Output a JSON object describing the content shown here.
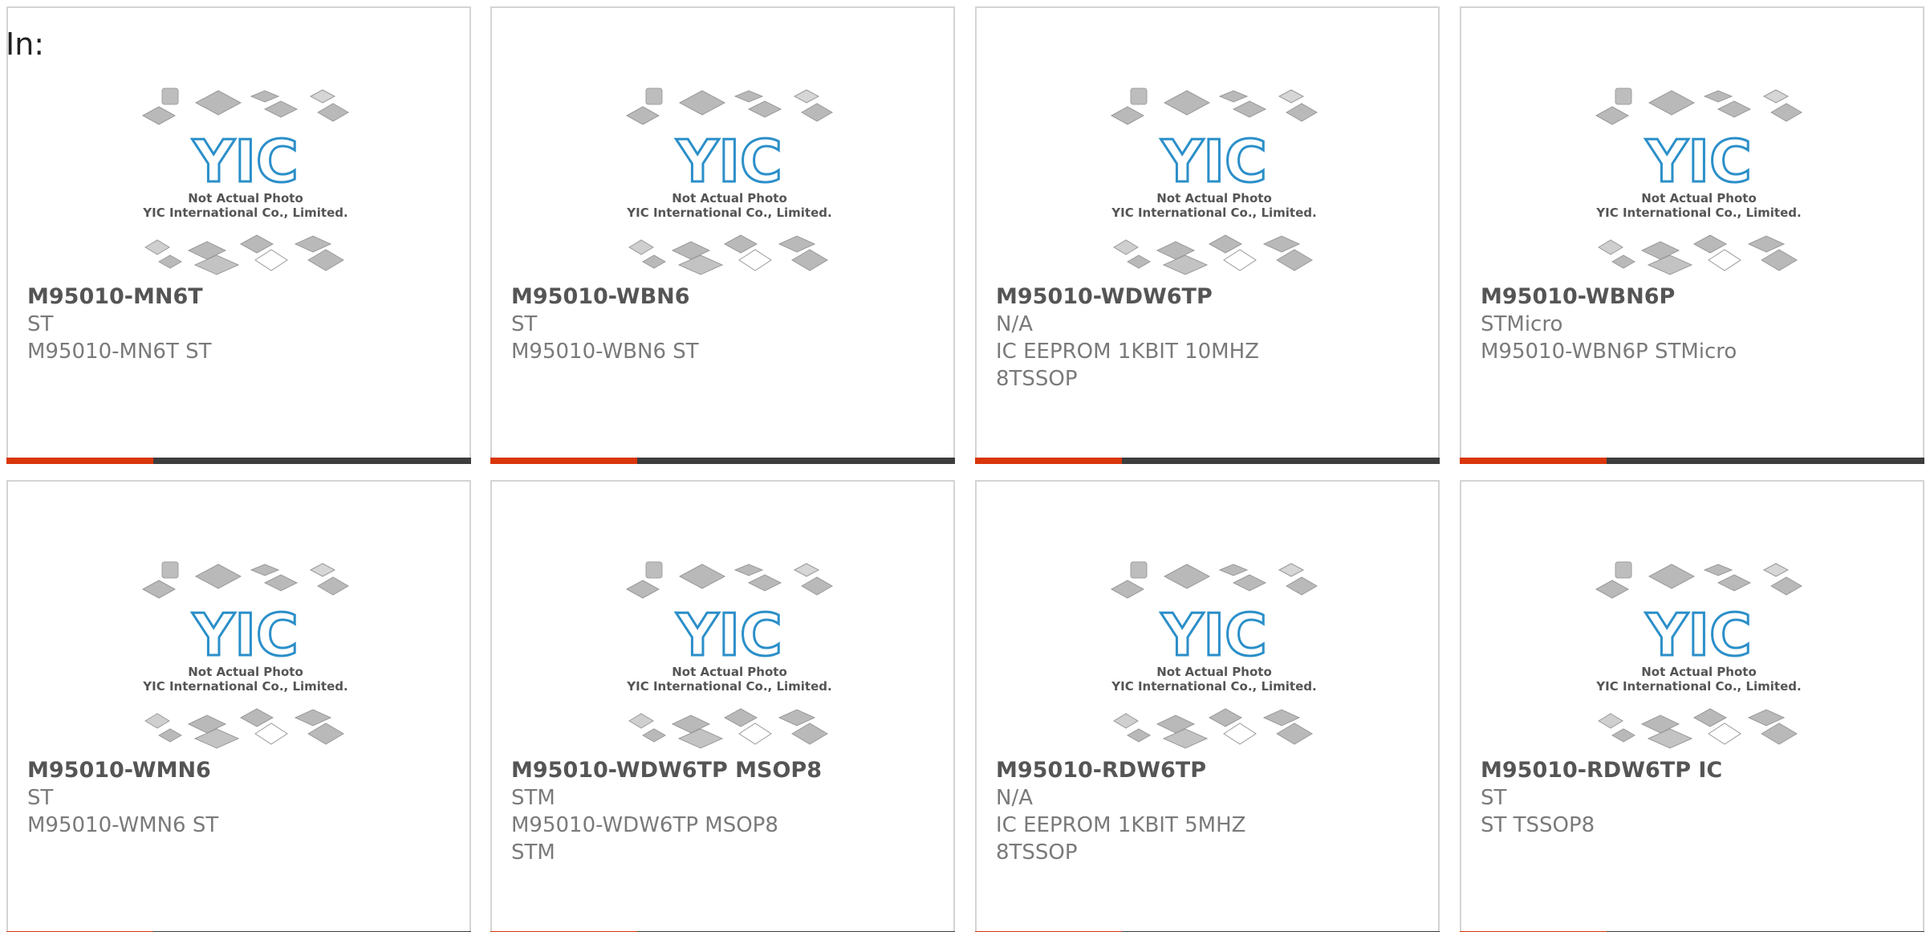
{
  "header": {
    "label": "In:"
  },
  "photo": {
    "logo_text": "YIC",
    "caption_line1": "Not Actual Photo",
    "caption_line2": "YIC International Co., Limited."
  },
  "colors": {
    "accent": "#d9360b",
    "bar": "#3d3d3d",
    "logo": "#2b8fc9"
  },
  "products": [
    {
      "part": "M95010-MN6T",
      "manufacturer": "ST",
      "description": "M95010-MN6T ST"
    },
    {
      "part": "M95010-WBN6",
      "manufacturer": "ST",
      "description": "M95010-WBN6 ST"
    },
    {
      "part": "M95010-WDW6TP",
      "manufacturer": "N/A",
      "description": "IC EEPROM 1KBIT 10MHZ 8TSSOP"
    },
    {
      "part": "M95010-WBN6P",
      "manufacturer": "STMicro",
      "description": "M95010-WBN6P STMicro"
    },
    {
      "part": "M95010-WMN6",
      "manufacturer": "ST",
      "description": "M95010-WMN6 ST"
    },
    {
      "part": "M95010-WDW6TP MSOP8",
      "manufacturer": "STM",
      "description": "M95010-WDW6TP MSOP8 STM"
    },
    {
      "part": "M95010-RDW6TP",
      "manufacturer": "N/A",
      "description": "IC EEPROM 1KBIT 5MHZ 8TSSOP"
    },
    {
      "part": "M95010-RDW6TP IC",
      "manufacturer": "ST",
      "description": "ST TSSOP8"
    }
  ]
}
